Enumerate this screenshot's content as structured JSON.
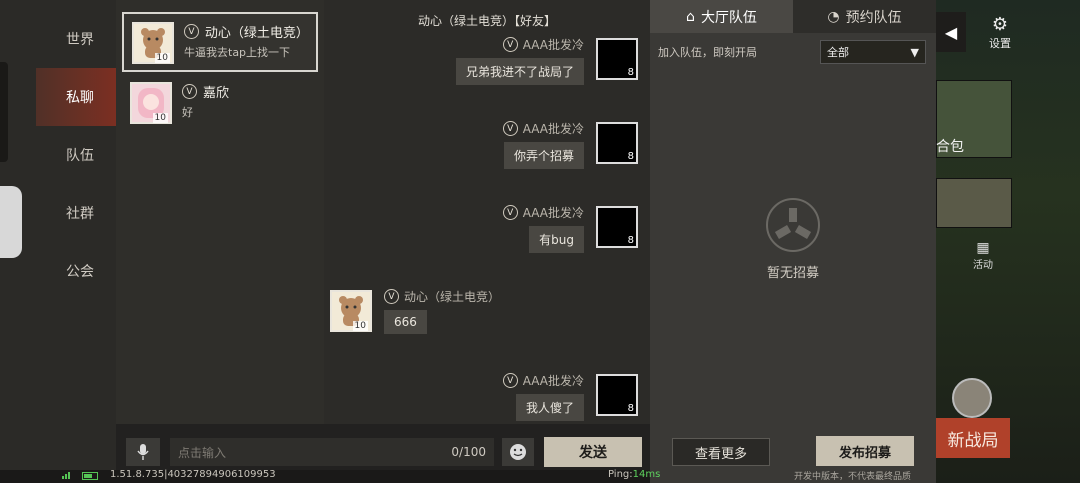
{
  "tabs": [
    "世界",
    "私聊",
    "队伍",
    "社群",
    "公会"
  ],
  "active_tab_index": 1,
  "contacts": [
    {
      "name": "动心（绿土电竞）",
      "message": "牛逼我去tap上找一下",
      "level": "10"
    },
    {
      "name": "嘉欣",
      "message": "好",
      "level": "10"
    }
  ],
  "chat": {
    "title": "动心（绿土电竞）【好友】",
    "messages": [
      {
        "sender": "AAA批发冷",
        "text": "兄弟我进不了战局了",
        "level": "8"
      },
      {
        "sender": "AAA批发冷",
        "text": "你弄个招募",
        "level": "8"
      },
      {
        "sender": "AAA批发冷",
        "text": "有bug",
        "level": "8"
      },
      {
        "sender": "动心（绿土电竞）",
        "text": "666",
        "level": "10"
      },
      {
        "sender": "AAA批发冷",
        "text": "我人傻了",
        "level": "8"
      }
    ]
  },
  "input": {
    "placeholder": "点击输入",
    "counter": "0/100",
    "send_label": "发送"
  },
  "team_panel": {
    "tab_lobby": "大厅队伍",
    "tab_reserve": "预约队伍",
    "join_text": "加入队伍，即刻开局",
    "filter_value": "全部",
    "empty_text": "暂无招募",
    "more_label": "查看更多",
    "post_label": "发布招募",
    "dev_note": "开发中版本，不代表最终品质"
  },
  "side": {
    "settings_label": "设置",
    "thumb_label": "合包",
    "activity_label": "活动",
    "new_battle_label": "新战局"
  },
  "status": {
    "version": "1.51.8.735|40327894906109953",
    "ping_label": "Ping:",
    "ping_value": "14ms"
  },
  "colors": {
    "accent_red": "#7c2f22",
    "send_button": "#c8c1b1",
    "new_battle": "#b0412a",
    "ping_green": "#5ed25e"
  }
}
